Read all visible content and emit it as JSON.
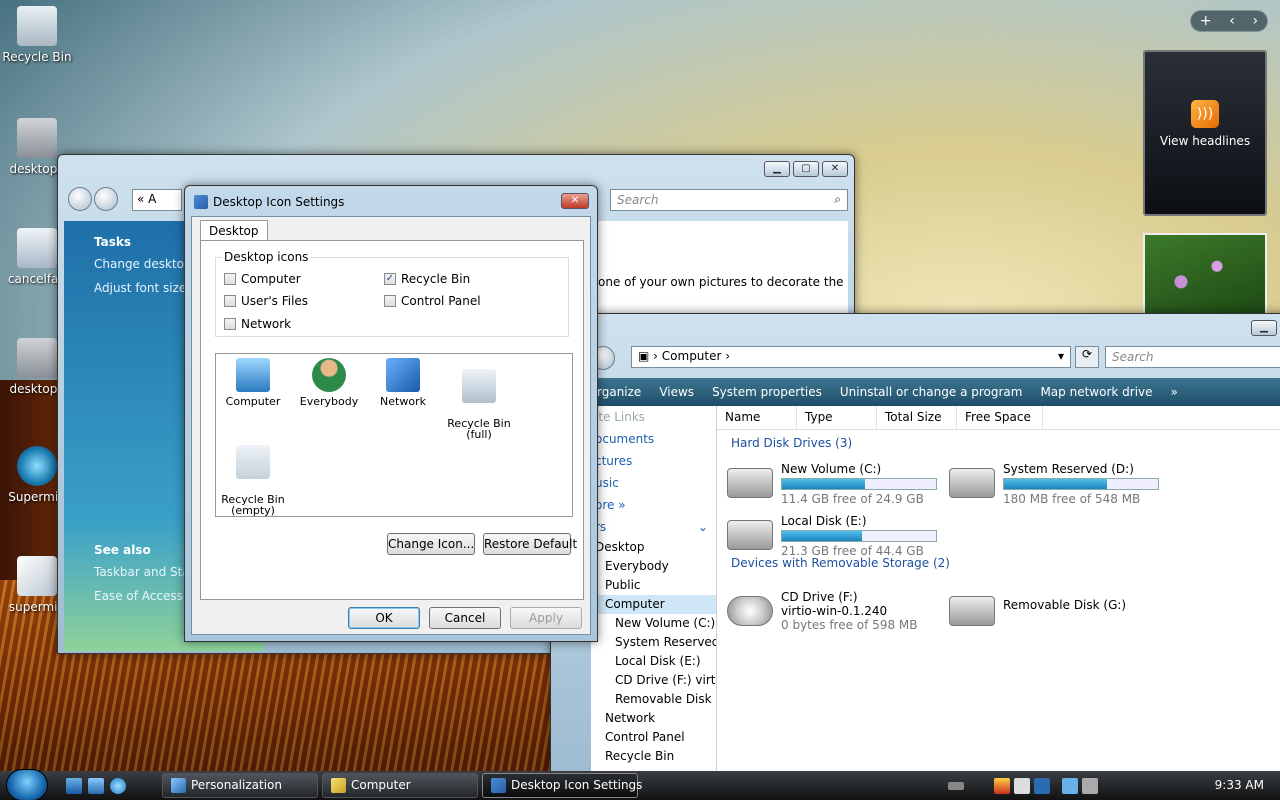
{
  "desktop": {
    "icons": [
      {
        "label": "Recycle Bin"
      },
      {
        "label": "desktop.i"
      },
      {
        "label": "cancelfag"
      },
      {
        "label": "desktop.i"
      },
      {
        "label": "Supermiu"
      },
      {
        "label": "supermiu"
      }
    ]
  },
  "sidebar": {
    "controls": [
      "+",
      "‹",
      "›"
    ],
    "feed_label": "View headlines"
  },
  "personalization": {
    "breadcrumb_prefix": "«",
    "breadcrumb_text": "A",
    "search_placeholder": "Search",
    "tasks_heading": "Tasks",
    "tasks": [
      "Change desktop i",
      "Adjust font size (D"
    ],
    "see_also_heading": "See also",
    "see_also": [
      "Taskbar and Start",
      "Ease of Access"
    ],
    "content_text": "one of your own pictures to decorate the"
  },
  "computer": {
    "address": "Computer",
    "search_placeholder": "Search",
    "toolbar": [
      "rganize",
      "Views",
      "System properties",
      "Uninstall or change a program",
      "Map network drive",
      "»"
    ],
    "nav_links": [
      "ite Links",
      "ocuments",
      "ctures",
      "usic",
      "ore  »"
    ],
    "folders_label": "rs",
    "folders": [
      "Desktop",
      "Everybody",
      "Public",
      "Computer",
      "New Volume (C:)",
      "System Reserved (",
      "Local Disk (E:)",
      "CD Drive (F:) virtic",
      "Removable Disk (G",
      "Network",
      "Control Panel",
      "Recycle Bin"
    ],
    "columns": [
      "Name",
      "Type",
      "Total Size",
      "Free Space"
    ],
    "groups": {
      "hdd": "Hard Disk Drives (3)",
      "removable": "Devices with Removable Storage (2)"
    },
    "drives": {
      "c": {
        "name": "New Volume (C:)",
        "free": "11.4 GB free of 24.9 GB",
        "used": 0.54
      },
      "d": {
        "name": "System Reserved (D:)",
        "free": "180 MB free of 548 MB",
        "used": 0.67
      },
      "e": {
        "name": "Local Disk (E:)",
        "free": "21.3 GB free of 44.4 GB",
        "used": 0.52
      },
      "f": {
        "name": "CD Drive (F:)",
        "sub": "virtio-win-0.1.240",
        "free": "0 bytes free of 598 MB"
      },
      "g": {
        "name": "Removable Disk (G:)"
      }
    }
  },
  "dialog": {
    "title": "Desktop Icon Settings",
    "close": "✕",
    "tab": "Desktop",
    "group_label": "Desktop icons",
    "checkboxes": [
      {
        "label": "Computer",
        "checked": false
      },
      {
        "label": "Recycle Bin",
        "checked": true
      },
      {
        "label": "User's Files",
        "checked": false
      },
      {
        "label": "Control Panel",
        "checked": false
      },
      {
        "label": "Network",
        "checked": false
      }
    ],
    "list_items": [
      {
        "label": "Computer"
      },
      {
        "label": "Everybody"
      },
      {
        "label": "Network"
      },
      {
        "label": "Recycle Bin\n(full)"
      },
      {
        "label": "Recycle Bin\n(empty)"
      }
    ],
    "change_icon": "Change Icon...",
    "restore_default": "Restore Default",
    "ok": "OK",
    "cancel": "Cancel",
    "apply": "Apply"
  },
  "taskbar": {
    "buttons": [
      "Personalization",
      "Computer",
      "Desktop Icon Settings"
    ],
    "clock": "9:33 AM"
  },
  "colors": {
    "accent": "#1c5fb0",
    "group_text": "#1c4fa0"
  }
}
